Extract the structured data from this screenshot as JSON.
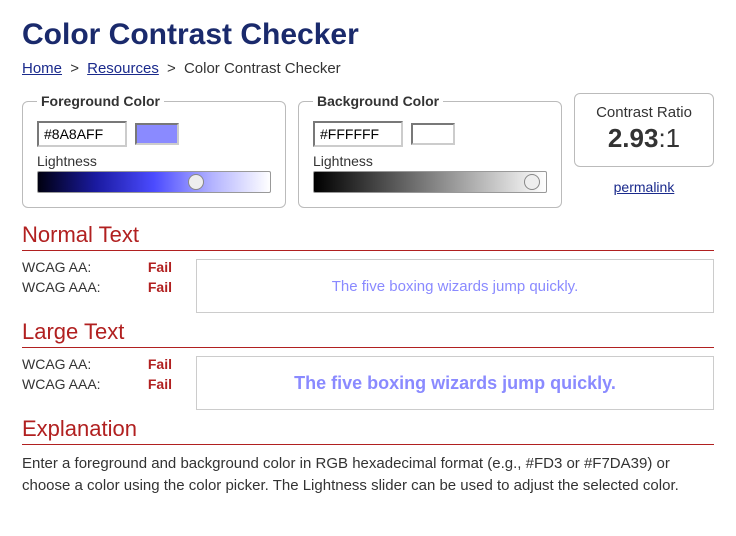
{
  "title": "Color Contrast Checker",
  "breadcrumb": {
    "home": "Home",
    "resources": "Resources",
    "current": "Color Contrast Checker"
  },
  "foreground": {
    "legend": "Foreground Color",
    "hex": "#8A8AFF",
    "lightness_label": "Lightness",
    "slider_pos_pct": 68,
    "gradient": "linear-gradient(to right, #000010, #1a1aa0, #4b4bff, #b3b3ff, #ffffff)"
  },
  "background": {
    "legend": "Background Color",
    "hex": "#FFFFFF",
    "lightness_label": "Lightness",
    "slider_pos_pct": 94,
    "gradient": "linear-gradient(to right, #000000, #ffffff)"
  },
  "ratio": {
    "label": "Contrast Ratio",
    "value_bold": "2.93",
    "value_rest": ":1",
    "permalink_label": "permalink"
  },
  "normal": {
    "title": "Normal Text",
    "aa_label": "WCAG AA:",
    "aa_status": "Fail",
    "aaa_label": "WCAG AAA:",
    "aaa_status": "Fail",
    "sample_text": "The five boxing wizards jump quickly."
  },
  "large": {
    "title": "Large Text",
    "aa_label": "WCAG AA:",
    "aa_status": "Fail",
    "aaa_label": "WCAG AAA:",
    "aaa_status": "Fail",
    "sample_text": "The five boxing wizards jump quickly."
  },
  "explanation": {
    "title": "Explanation",
    "text": "Enter a foreground and background color in RGB hexadecimal format (e.g., #FD3 or #F7DA39) or choose a color using the color picker. The Lightness slider can be used to adjust the selected color."
  }
}
